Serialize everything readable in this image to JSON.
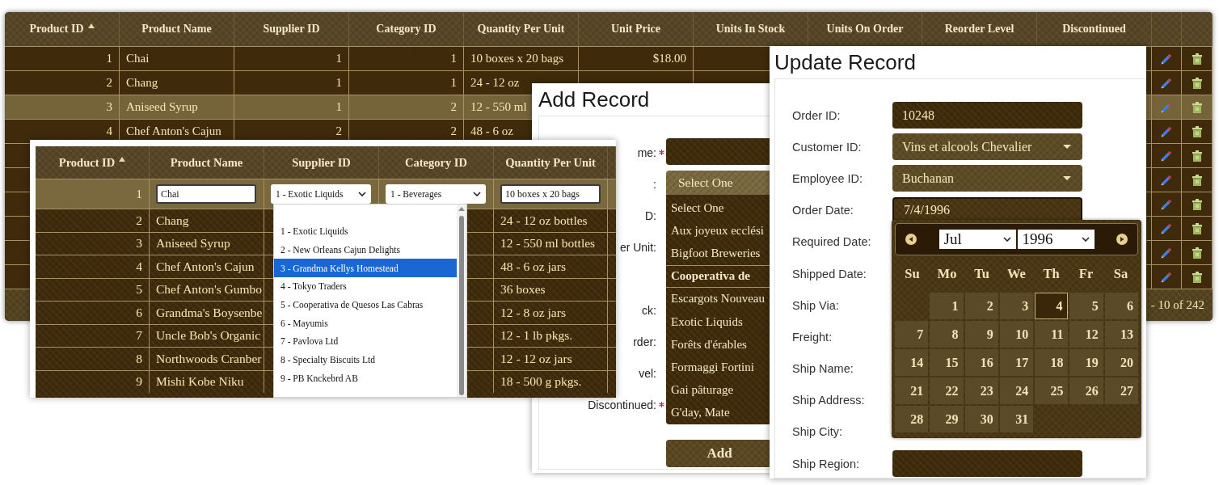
{
  "products_grid": {
    "columns": [
      {
        "label": "Product ID",
        "sorted": true
      },
      {
        "label": "Product Name",
        "sorted": false
      },
      {
        "label": "Supplier ID",
        "sorted": false
      },
      {
        "label": "Category ID",
        "sorted": false
      },
      {
        "label": "Quantity Per Unit",
        "sorted": false
      },
      {
        "label": "Unit Price",
        "sorted": false
      },
      {
        "label": "Units In Stock",
        "sorted": false
      },
      {
        "label": "Units On Order",
        "sorted": false
      },
      {
        "label": "Reorder Level",
        "sorted": false
      },
      {
        "label": "Discontinued",
        "sorted": false
      }
    ],
    "rows": [
      {
        "cells": [
          "1",
          "Chai",
          "1",
          "1",
          "10 boxes x 20 bags",
          "$18.00"
        ],
        "selected": false
      },
      {
        "cells": [
          "2",
          "Chang",
          "1",
          "1",
          "24 - 12 oz"
        ],
        "selected": false
      },
      {
        "cells": [
          "3",
          "Aniseed Syrup",
          "1",
          "2",
          "12 - 550 ml"
        ],
        "selected": true
      },
      {
        "cells": [
          "4",
          "Chef Anton's Cajun",
          "2",
          "2",
          "48 - 6 oz"
        ],
        "selected": false
      },
      {
        "selected": false
      },
      {
        "selected": false
      },
      {
        "selected": false
      },
      {
        "selected": false
      },
      {
        "selected": false
      },
      {
        "selected": false
      }
    ],
    "pager": "- 10 of 242"
  },
  "inline_edit_grid": {
    "columns": [
      {
        "label": "Product ID",
        "sorted": true
      },
      {
        "label": "Product Name",
        "sorted": false
      },
      {
        "label": "Supplier ID",
        "sorted": false
      },
      {
        "label": "Category ID",
        "sorted": false
      },
      {
        "label": "Quantity Per Unit",
        "sorted": false
      }
    ],
    "edit_row": {
      "id": "1",
      "name": "Chai",
      "supplier": "1 - Exotic Liquids",
      "category": "1 - Beverages",
      "quantity": "10 boxes x 20 bags"
    },
    "rows": [
      {
        "id": "2",
        "name": "Chang",
        "quantity": "24 - 12 oz bottles"
      },
      {
        "id": "3",
        "name": "Aniseed Syrup",
        "quantity": "12 - 550 ml bottles"
      },
      {
        "id": "4",
        "name": "Chef Anton's Cajun",
        "quantity": "48 - 6 oz jars"
      },
      {
        "id": "5",
        "name": "Chef Anton's Gumbo",
        "quantity": "36 boxes"
      },
      {
        "id": "6",
        "name": "Grandma's Boysenbe",
        "quantity": "12 - 8 oz jars"
      },
      {
        "id": "7",
        "name": "Uncle Bob's Organic",
        "quantity": "12 - 1 lb pkgs."
      },
      {
        "id": "8",
        "name": "Northwoods Cranber",
        "quantity": "12 - 12 oz jars"
      },
      {
        "id": "9",
        "name": "Mishi Kobe Niku",
        "quantity": "18 - 500 g pkgs."
      }
    ],
    "supplier_options": [
      {
        "label": "1 - Exotic Liquids",
        "selected": false
      },
      {
        "label": "2 - New Orleans Cajun Delights",
        "selected": false
      },
      {
        "label": "3 - Grandma Kellys Homestead",
        "selected": true
      },
      {
        "label": "4 - Tokyo Traders",
        "selected": false
      },
      {
        "label": "5 - Cooperativa de Quesos Las Cabras",
        "selected": false
      },
      {
        "label": "6 - Mayumis",
        "selected": false
      },
      {
        "label": "7 - Pavlova Ltd",
        "selected": false
      },
      {
        "label": "8 - Specialty Biscuits Ltd",
        "selected": false
      },
      {
        "label": "9 - PB Knckebrd AB",
        "selected": false
      }
    ]
  },
  "add_record": {
    "title": "Add Record",
    "labels": [
      {
        "text": "me:",
        "required": true
      },
      {
        "text": ":",
        "required": false
      },
      {
        "text": "D:",
        "required": false
      },
      {
        "text": "er Unit:",
        "required": false
      },
      {
        "text": "ck:",
        "required": false
      },
      {
        "text": "rder:",
        "required": false
      },
      {
        "text": "vel:",
        "required": false
      },
      {
        "text": "Discontinued:",
        "required": true
      }
    ],
    "supplier_dropdown": {
      "value": "Select One",
      "options": [
        {
          "label": "Select One",
          "highlighted": false
        },
        {
          "label": "Aux joyeux ecclési",
          "highlighted": false
        },
        {
          "label": "Bigfoot Breweries",
          "highlighted": false
        },
        {
          "label": "Cooperativa de",
          "highlighted": true
        },
        {
          "label": "Escargots Nouveau",
          "highlighted": false
        },
        {
          "label": "Exotic Liquids",
          "highlighted": false
        },
        {
          "label": "Forêts d'érables",
          "highlighted": false
        },
        {
          "label": "Formaggi Fortini",
          "highlighted": false
        },
        {
          "label": "Gai pâturage",
          "highlighted": false
        },
        {
          "label": "G'day, Mate",
          "highlighted": false
        }
      ]
    },
    "button": "Add"
  },
  "update_record": {
    "title": "Update Record",
    "fields": [
      {
        "label": "Order ID:",
        "kind": "text",
        "value": "10248"
      },
      {
        "label": "Customer ID:",
        "kind": "select",
        "value": "Vins et alcools Chevalier"
      },
      {
        "label": "Employee ID:",
        "kind": "select",
        "value": "Buchanan"
      },
      {
        "label": "Order Date:",
        "kind": "text",
        "value": "7/4/1996",
        "focused": true
      },
      {
        "label": "Required Date:"
      },
      {
        "label": "Shipped Date:"
      },
      {
        "label": "Ship Via:"
      },
      {
        "label": "Freight:"
      },
      {
        "label": "Ship Name:"
      },
      {
        "label": "Ship Address:"
      },
      {
        "label": "Ship City:"
      },
      {
        "label": "Ship Region:",
        "kind": "text"
      }
    ],
    "calendar": {
      "month": "Jul",
      "year": "1996",
      "weekdays": [
        "Su",
        "Mo",
        "Tu",
        "We",
        "Th",
        "Fr",
        "Sa"
      ],
      "weeks": [
        [
          {
            "kind": "blank"
          },
          {
            "label": "1",
            "selected": false
          },
          {
            "label": "2",
            "selected": false
          },
          {
            "label": "3",
            "selected": false
          },
          {
            "label": "4",
            "selected": true
          },
          {
            "label": "5",
            "selected": false
          },
          {
            "label": "6",
            "selected": false
          }
        ],
        [
          {
            "label": "7",
            "selected": false
          },
          {
            "label": "8",
            "selected": false
          },
          {
            "label": "9",
            "selected": false
          },
          {
            "label": "10",
            "selected": false
          },
          {
            "label": "11",
            "selected": false
          },
          {
            "label": "12",
            "selected": false
          },
          {
            "label": "13",
            "selected": false
          }
        ],
        [
          {
            "label": "14",
            "selected": false
          },
          {
            "label": "15",
            "selected": false
          },
          {
            "label": "16",
            "selected": false
          },
          {
            "label": "17",
            "selected": false
          },
          {
            "label": "18",
            "selected": false
          },
          {
            "label": "19",
            "selected": false
          },
          {
            "label": "20",
            "selected": false
          }
        ],
        [
          {
            "label": "21",
            "selected": false
          },
          {
            "label": "22",
            "selected": false
          },
          {
            "label": "23",
            "selected": false
          },
          {
            "label": "24",
            "selected": false
          },
          {
            "label": "25",
            "selected": false
          },
          {
            "label": "26",
            "selected": false
          },
          {
            "label": "27",
            "selected": false
          }
        ],
        [
          {
            "label": "28",
            "selected": false
          },
          {
            "label": "29",
            "selected": false
          },
          {
            "label": "30",
            "selected": false
          },
          {
            "label": "31",
            "selected": false
          }
        ]
      ]
    }
  }
}
